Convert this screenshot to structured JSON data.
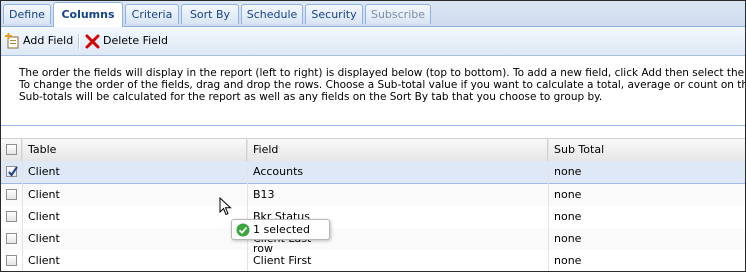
{
  "tabs": [
    {
      "label": "Define",
      "state": "normal"
    },
    {
      "label": "Columns",
      "state": "active"
    },
    {
      "label": "Criteria",
      "state": "normal"
    },
    {
      "label": "Sort By",
      "state": "normal"
    },
    {
      "label": "Schedule",
      "state": "normal"
    },
    {
      "label": "Security",
      "state": "normal"
    },
    {
      "label": "Subscribe",
      "state": "disabled"
    }
  ],
  "toolbar": {
    "add_field_label": "Add Field",
    "delete_field_label": "Delete Field"
  },
  "description": {
    "line1": "The order the fields will display in the report (left to right) is displayed below (top to bottom). To add a new field, click Add then select the Table and Fie",
    "line2": "To change the order of the fields, drag and drop the rows. Choose a Sub-total value if you want to calculate a total, average or count on the selected f",
    "line3": "Sub-totals will be calculated for the report as well as any fields on the Sort By tab that you choose to group by."
  },
  "grid": {
    "columns": [
      "Table",
      "Field",
      "Sub Total"
    ],
    "rows": [
      {
        "table": "Client",
        "field": "Accounts",
        "subtotal": "none",
        "checked": true
      },
      {
        "table": "Client",
        "field": "B13",
        "subtotal": "none",
        "checked": false
      },
      {
        "table": "Client",
        "field": "Bkr Status",
        "subtotal": "none",
        "checked": false
      },
      {
        "table": "Client",
        "field": "Client Last",
        "subtotal": "none",
        "checked": false
      },
      {
        "table": "Client",
        "field": "Client First",
        "subtotal": "none",
        "checked": false
      }
    ]
  },
  "tooltip": {
    "text": "1 selected row"
  },
  "colors": {
    "tab_text": "#15428b",
    "selected_row": "#dfe8f6",
    "delete_icon": "#d40000",
    "success_icon": "#3aa53a"
  },
  "icons": {
    "add": "add-field-icon",
    "delete": "delete-icon",
    "check": "checkmark-icon",
    "success": "success-check-icon",
    "cursor": "mouse-pointer-icon"
  }
}
